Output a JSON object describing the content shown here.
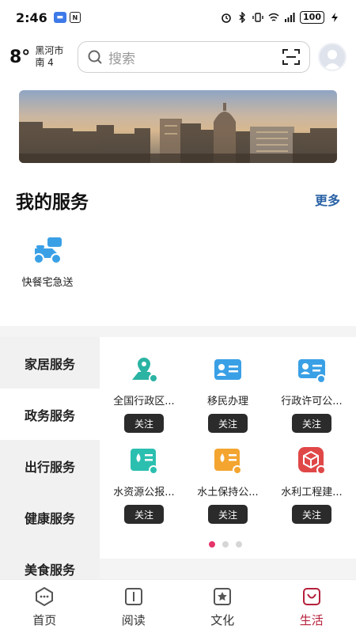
{
  "status_bar": {
    "time": "2:46",
    "battery": "100"
  },
  "header": {
    "weather": {
      "temp": "8°",
      "city": "黑河市",
      "wind": "南 4"
    },
    "search": {
      "placeholder": "搜索"
    }
  },
  "my_services": {
    "title": "我的服务",
    "more": "更多",
    "items": [
      {
        "label": "快餐宅急送",
        "icon": "scooter-icon"
      }
    ]
  },
  "categories": [
    "家居服务",
    "政务服务",
    "出行服务",
    "健康服务",
    "美食服务"
  ],
  "active_category": "政务服务",
  "services": [
    {
      "label": "全国行政区...",
      "button": "关注",
      "icon": "map-pin-icon",
      "color": "#2bb3a3"
    },
    {
      "label": "移民办理",
      "button": "关注",
      "icon": "id-card-icon",
      "color": "#3aa0e6"
    },
    {
      "label": "行政许可公...",
      "button": "关注",
      "icon": "license-card-icon",
      "color": "#3aa0e6"
    },
    {
      "label": "水资源公报...",
      "button": "关注",
      "icon": "water-doc-icon",
      "color": "#2bbfb0"
    },
    {
      "label": "水土保持公...",
      "button": "关注",
      "icon": "soil-doc-icon",
      "color": "#f3a530"
    },
    {
      "label": "水利工程建...",
      "button": "关注",
      "icon": "box-icon",
      "color": "#e04848"
    }
  ],
  "pager": {
    "pages": 3,
    "current": 1
  },
  "bottom_nav": [
    {
      "label": "首页",
      "icon": "home-icon"
    },
    {
      "label": "阅读",
      "icon": "book-icon"
    },
    {
      "label": "文化",
      "icon": "star-icon"
    },
    {
      "label": "生活",
      "icon": "life-icon",
      "active": true
    }
  ],
  "colors": {
    "accent": "#b5203c",
    "link": "#2a62a6",
    "pager_active": "#e5356b",
    "button_dark": "#2b2b2b"
  }
}
